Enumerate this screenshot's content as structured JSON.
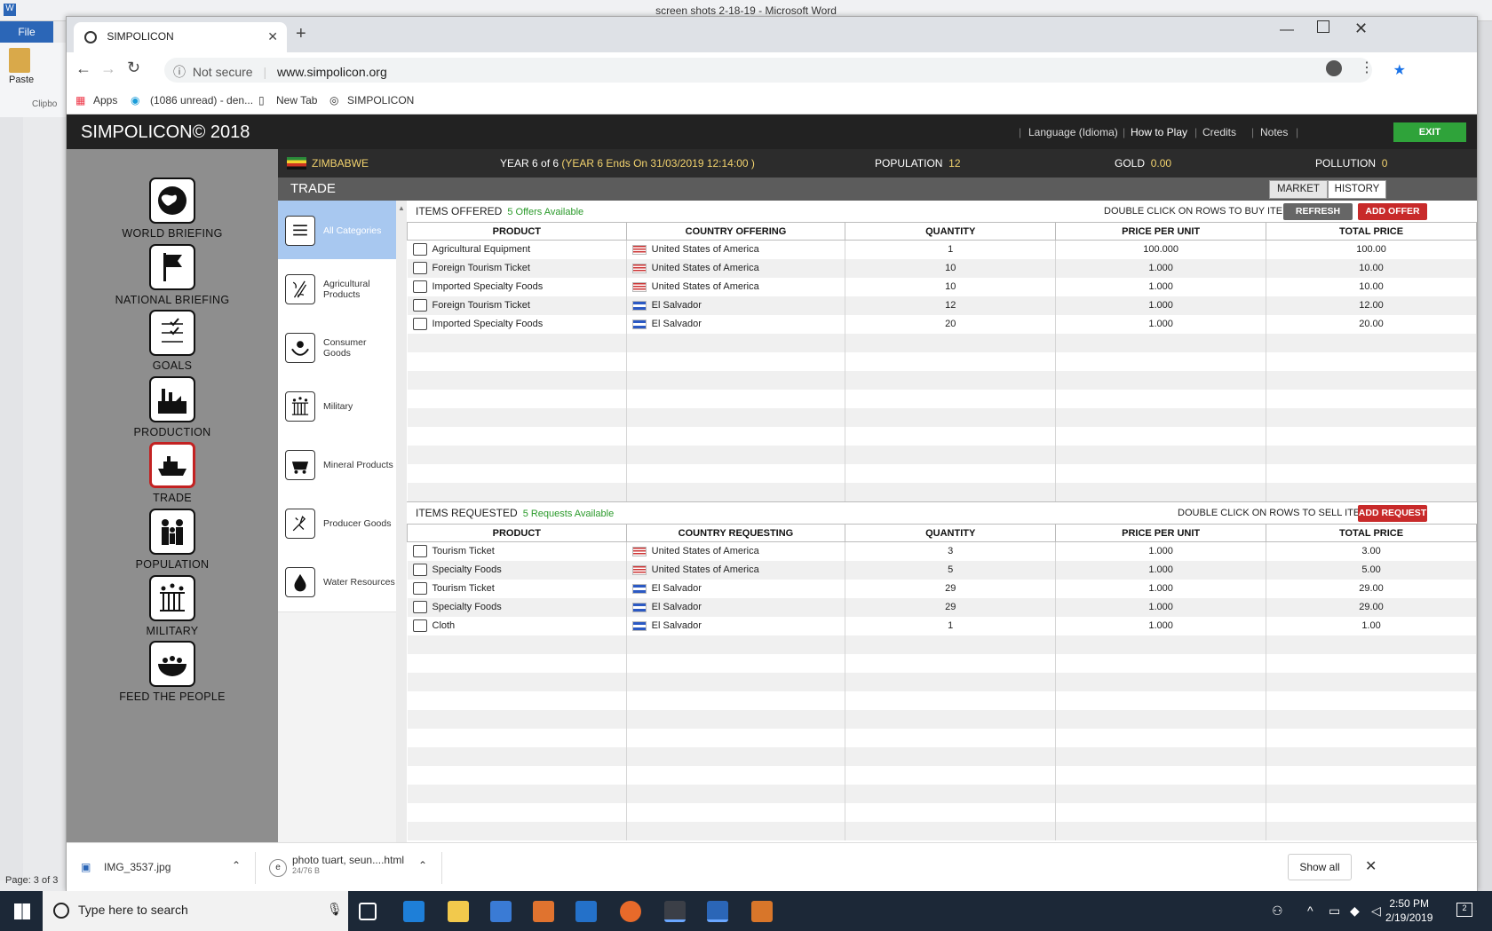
{
  "word": {
    "title": "screen shots 2-18-19  -  Microsoft Word",
    "file_tab": "File",
    "paste_label": "Paste",
    "clipboard_label": "Clipbo",
    "status": "Page: 3 of 3"
  },
  "browser": {
    "tab_title": "SIMPOLICON",
    "security": "Not secure",
    "url": "www.simpolicon.org",
    "bookmarks": [
      "Apps",
      "(1086 unread) - den...",
      "New Tab",
      "SIMPOLICON"
    ]
  },
  "app": {
    "title": "SIMPOLICON© 2018",
    "header_links": [
      "Language (Idioma)",
      "How to Play",
      "Credits",
      "Notes"
    ],
    "exit_label": "EXIT",
    "country": "ZIMBABWE",
    "year_text": "YEAR  6 of 6",
    "year_ends": "(YEAR 6 Ends On 31/03/2019 12:14:00 )",
    "population_label": "POPULATION",
    "population_value": "12",
    "gold_label": "GOLD",
    "gold_value": "0.00",
    "pollution_label": "POLLUTION",
    "pollution_value": "0",
    "section": "TRADE",
    "market_label": "MARKET",
    "history_label": "HISTORY"
  },
  "sidebar": [
    {
      "label": "WORLD BRIEFING",
      "icon": "globe-icon"
    },
    {
      "label": "NATIONAL BRIEFING",
      "icon": "flag-icon"
    },
    {
      "label": "GOALS",
      "icon": "checklist-icon"
    },
    {
      "label": "PRODUCTION",
      "icon": "factory-icon"
    },
    {
      "label": "TRADE",
      "icon": "ship-icon"
    },
    {
      "label": "POPULATION",
      "icon": "people-icon"
    },
    {
      "label": "MILITARY",
      "icon": "soldiers-icon"
    },
    {
      "label": "FEED THE PEOPLE",
      "icon": "food-bowl-icon"
    }
  ],
  "categories": [
    {
      "label": "All Categories",
      "icon": "list-icon"
    },
    {
      "label": "Agricultural Products",
      "icon": "wheat-icon"
    },
    {
      "label": "Consumer Goods",
      "icon": "hands-icon"
    },
    {
      "label": "Military",
      "icon": "soldiers-icon"
    },
    {
      "label": "Mineral Products",
      "icon": "minecart-icon"
    },
    {
      "label": "Producer Goods",
      "icon": "tools-icon"
    },
    {
      "label": "Water Resources",
      "icon": "water-drop-icon"
    }
  ],
  "offered": {
    "title": "ITEMS OFFERED",
    "count": "5 Offers Available",
    "hint": "DOUBLE CLICK ON ROWS TO BUY ITEMS.",
    "refresh_label": "REFRESH",
    "add_label": "ADD OFFER",
    "columns": [
      "PRODUCT",
      "COUNTRY OFFERING",
      "QUANTITY",
      "PRICE PER UNIT",
      "TOTAL PRICE"
    ],
    "rows": [
      {
        "product": "Agricultural Equipment",
        "flag": "us",
        "country": "United States of America",
        "quantity": "1",
        "price": "100.000",
        "total": "100.00"
      },
      {
        "product": "Foreign Tourism Ticket",
        "flag": "us",
        "country": "United States of America",
        "quantity": "10",
        "price": "1.000",
        "total": "10.00"
      },
      {
        "product": "Imported Specialty Foods",
        "flag": "us",
        "country": "United States of America",
        "quantity": "10",
        "price": "1.000",
        "total": "10.00"
      },
      {
        "product": "Foreign Tourism Ticket",
        "flag": "sv",
        "country": "El Salvador",
        "quantity": "12",
        "price": "1.000",
        "total": "12.00"
      },
      {
        "product": "Imported Specialty Foods",
        "flag": "sv",
        "country": "El Salvador",
        "quantity": "20",
        "price": "1.000",
        "total": "20.00"
      }
    ]
  },
  "requested": {
    "title": "ITEMS REQUESTED",
    "count": "5 Requests Available",
    "hint": "DOUBLE CLICK ON ROWS TO SELL ITEMS.",
    "add_label": "ADD REQUEST",
    "columns": [
      "PRODUCT",
      "COUNTRY REQUESTING",
      "QUANTITY",
      "PRICE PER UNIT",
      "TOTAL PRICE"
    ],
    "rows": [
      {
        "product": "Tourism Ticket",
        "flag": "us",
        "country": "United States of America",
        "quantity": "3",
        "price": "1.000",
        "total": "3.00"
      },
      {
        "product": "Specialty Foods",
        "flag": "us",
        "country": "United States of America",
        "quantity": "5",
        "price": "1.000",
        "total": "5.00"
      },
      {
        "product": "Tourism Ticket",
        "flag": "sv",
        "country": "El Salvador",
        "quantity": "29",
        "price": "1.000",
        "total": "29.00"
      },
      {
        "product": "Specialty Foods",
        "flag": "sv",
        "country": "El Salvador",
        "quantity": "29",
        "price": "1.000",
        "total": "29.00"
      },
      {
        "product": "Cloth",
        "flag": "sv",
        "country": "El Salvador",
        "quantity": "1",
        "price": "1.000",
        "total": "1.00"
      }
    ]
  },
  "downloads": [
    {
      "name": "IMG_3537.jpg"
    },
    {
      "name": "photo tuart, seun....html",
      "sub": "24/76 B"
    }
  ],
  "show_all": "Show all",
  "taskbar": {
    "search_placeholder": "Type here to search",
    "time": "2:50 PM",
    "date": "2/19/2019",
    "notif": "2"
  },
  "colors": {
    "exit": "#2fa33a",
    "add": "#c82a2a",
    "refresh": "#666666",
    "count": "#2a9a2a"
  }
}
